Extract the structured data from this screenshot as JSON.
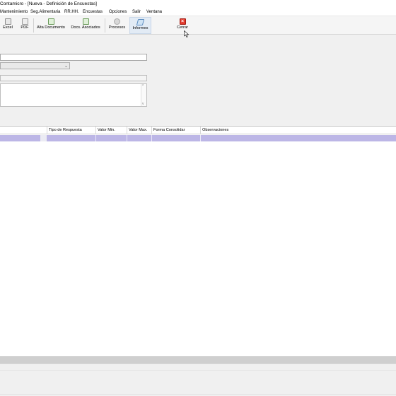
{
  "window": {
    "title": "Contamicro - [Nueva - Definición de Encuestas]"
  },
  "menu": {
    "items": [
      "Mantenimiento",
      "Seg.Alimentaria",
      "RR.HH.",
      "Encuestas",
      "Opciones",
      "Salir",
      "Ventana"
    ]
  },
  "toolbar": {
    "buttons": [
      {
        "label": "Excel",
        "icon": "excel-icon"
      },
      {
        "label": "PDF",
        "icon": "pdf-icon"
      },
      {
        "label": "Alta Documento",
        "icon": "new-document-icon"
      },
      {
        "label": "Docs. Asociados",
        "icon": "associated-docs-icon"
      },
      {
        "label": "Procesos",
        "icon": "processes-icon"
      },
      {
        "label": "Informes",
        "icon": "reports-icon"
      },
      {
        "label": "Cerrar",
        "icon": "close-icon"
      }
    ],
    "active": "Informes"
  },
  "grid": {
    "columns": [
      "Tipo de Respuesta",
      "Valor Min.",
      "Valor Max.",
      "Forma Consolidar",
      "Observaciones"
    ],
    "selected_row_color": "#bcb6e6"
  },
  "colors": {
    "close_button": "#e23b2e",
    "selection": "#bcb6e6"
  }
}
